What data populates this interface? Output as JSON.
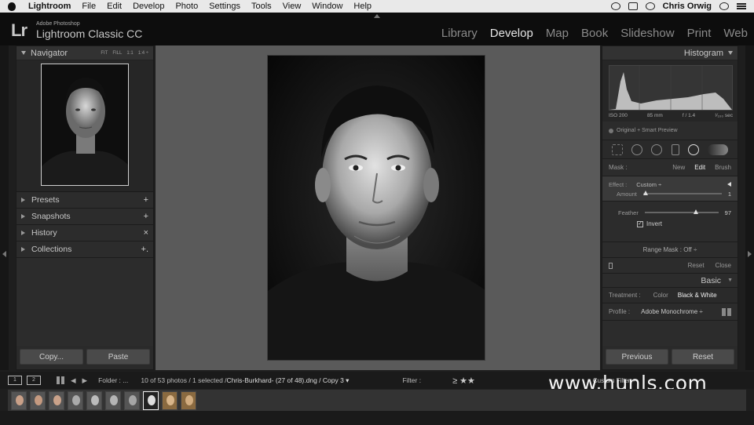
{
  "menubar": {
    "app": "Lightroom",
    "items": [
      "File",
      "Edit",
      "Develop",
      "Photo",
      "Settings",
      "Tools",
      "View",
      "Window",
      "Help"
    ],
    "user": "Chris Orwig"
  },
  "identity": {
    "logo": "Lr",
    "sub1": "Adobe Photoshop",
    "sub2": "Lightroom Classic CC",
    "modules": [
      "Library",
      "Develop",
      "Map",
      "Book",
      "Slideshow",
      "Print",
      "Web"
    ],
    "active_module": "Develop"
  },
  "left": {
    "navigator": {
      "title": "Navigator",
      "opts": [
        "FIT",
        "FILL",
        "1:1",
        "1:4 ÷"
      ]
    },
    "sections": [
      {
        "label": "Presets",
        "action": "+"
      },
      {
        "label": "Snapshots",
        "action": "+"
      },
      {
        "label": "History",
        "action": "×"
      },
      {
        "label": "Collections",
        "action": "+."
      }
    ],
    "copy": "Copy...",
    "paste": "Paste"
  },
  "right": {
    "histogram": {
      "title": "Histogram",
      "iso": "ISO 200",
      "focal": "85 mm",
      "aperture": "f / 1.4",
      "shutter": "¹⁄₁₀₀ sec",
      "smart": "Original + Smart Preview"
    },
    "mask": {
      "label": "Mask :",
      "new": "New",
      "edit": "Edit",
      "brush": "Brush"
    },
    "effect": {
      "label": "Effect :",
      "value": "Custom ÷",
      "amount_label": "Amount",
      "amount_value": "1"
    },
    "feather": {
      "label": "Feather",
      "value": "97",
      "invert": "Invert"
    },
    "range_mask": "Range Mask : Off ÷",
    "reset": "Reset",
    "close": "Close",
    "basic": {
      "title": "Basic",
      "treatment_label": "Treatment :",
      "color": "Color",
      "bw": "Black & White",
      "profile_label": "Profile :",
      "profile_value": "Adobe Monochrome ÷"
    },
    "previous": "Previous",
    "reset_btn": "Reset"
  },
  "filmstrip": {
    "mon1": "1",
    "mon2": "2",
    "folder": "Folder : ...",
    "count": "10 of 53 photos / 1 selected /",
    "file": "Chris-Burkhard- (27 of 48).dng / Copy 3 ▾",
    "filter": "Filter :",
    "stars": "≥ ★★",
    "custom": "Custom Filter ÷",
    "thumb_count": 10,
    "selected_index": 7
  },
  "watermark": "www.hunls.com",
  "colors": {
    "accent": "#e6e6e6",
    "panel": "#2c2c2c",
    "center_bg": "#5a5a5a"
  }
}
